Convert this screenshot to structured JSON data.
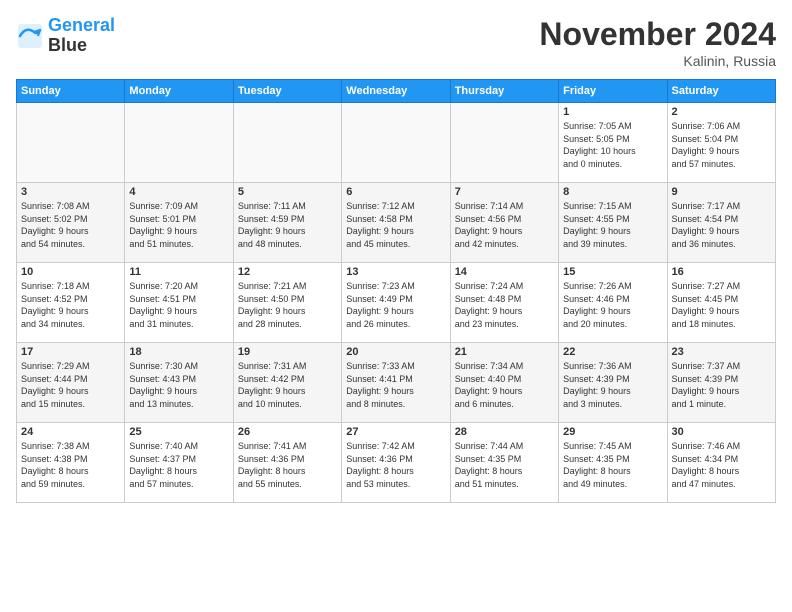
{
  "logo": {
    "line1": "General",
    "line2": "Blue"
  },
  "title": "November 2024",
  "location": "Kalinin, Russia",
  "days_header": [
    "Sunday",
    "Monday",
    "Tuesday",
    "Wednesday",
    "Thursday",
    "Friday",
    "Saturday"
  ],
  "weeks": [
    [
      {
        "day": "",
        "text": ""
      },
      {
        "day": "",
        "text": ""
      },
      {
        "day": "",
        "text": ""
      },
      {
        "day": "",
        "text": ""
      },
      {
        "day": "",
        "text": ""
      },
      {
        "day": "1",
        "text": "Sunrise: 7:05 AM\nSunset: 5:05 PM\nDaylight: 10 hours\nand 0 minutes."
      },
      {
        "day": "2",
        "text": "Sunrise: 7:06 AM\nSunset: 5:04 PM\nDaylight: 9 hours\nand 57 minutes."
      }
    ],
    [
      {
        "day": "3",
        "text": "Sunrise: 7:08 AM\nSunset: 5:02 PM\nDaylight: 9 hours\nand 54 minutes."
      },
      {
        "day": "4",
        "text": "Sunrise: 7:09 AM\nSunset: 5:01 PM\nDaylight: 9 hours\nand 51 minutes."
      },
      {
        "day": "5",
        "text": "Sunrise: 7:11 AM\nSunset: 4:59 PM\nDaylight: 9 hours\nand 48 minutes."
      },
      {
        "day": "6",
        "text": "Sunrise: 7:12 AM\nSunset: 4:58 PM\nDaylight: 9 hours\nand 45 minutes."
      },
      {
        "day": "7",
        "text": "Sunrise: 7:14 AM\nSunset: 4:56 PM\nDaylight: 9 hours\nand 42 minutes."
      },
      {
        "day": "8",
        "text": "Sunrise: 7:15 AM\nSunset: 4:55 PM\nDaylight: 9 hours\nand 39 minutes."
      },
      {
        "day": "9",
        "text": "Sunrise: 7:17 AM\nSunset: 4:54 PM\nDaylight: 9 hours\nand 36 minutes."
      }
    ],
    [
      {
        "day": "10",
        "text": "Sunrise: 7:18 AM\nSunset: 4:52 PM\nDaylight: 9 hours\nand 34 minutes."
      },
      {
        "day": "11",
        "text": "Sunrise: 7:20 AM\nSunset: 4:51 PM\nDaylight: 9 hours\nand 31 minutes."
      },
      {
        "day": "12",
        "text": "Sunrise: 7:21 AM\nSunset: 4:50 PM\nDaylight: 9 hours\nand 28 minutes."
      },
      {
        "day": "13",
        "text": "Sunrise: 7:23 AM\nSunset: 4:49 PM\nDaylight: 9 hours\nand 26 minutes."
      },
      {
        "day": "14",
        "text": "Sunrise: 7:24 AM\nSunset: 4:48 PM\nDaylight: 9 hours\nand 23 minutes."
      },
      {
        "day": "15",
        "text": "Sunrise: 7:26 AM\nSunset: 4:46 PM\nDaylight: 9 hours\nand 20 minutes."
      },
      {
        "day": "16",
        "text": "Sunrise: 7:27 AM\nSunset: 4:45 PM\nDaylight: 9 hours\nand 18 minutes."
      }
    ],
    [
      {
        "day": "17",
        "text": "Sunrise: 7:29 AM\nSunset: 4:44 PM\nDaylight: 9 hours\nand 15 minutes."
      },
      {
        "day": "18",
        "text": "Sunrise: 7:30 AM\nSunset: 4:43 PM\nDaylight: 9 hours\nand 13 minutes."
      },
      {
        "day": "19",
        "text": "Sunrise: 7:31 AM\nSunset: 4:42 PM\nDaylight: 9 hours\nand 10 minutes."
      },
      {
        "day": "20",
        "text": "Sunrise: 7:33 AM\nSunset: 4:41 PM\nDaylight: 9 hours\nand 8 minutes."
      },
      {
        "day": "21",
        "text": "Sunrise: 7:34 AM\nSunset: 4:40 PM\nDaylight: 9 hours\nand 6 minutes."
      },
      {
        "day": "22",
        "text": "Sunrise: 7:36 AM\nSunset: 4:39 PM\nDaylight: 9 hours\nand 3 minutes."
      },
      {
        "day": "23",
        "text": "Sunrise: 7:37 AM\nSunset: 4:39 PM\nDaylight: 9 hours\nand 1 minute."
      }
    ],
    [
      {
        "day": "24",
        "text": "Sunrise: 7:38 AM\nSunset: 4:38 PM\nDaylight: 8 hours\nand 59 minutes."
      },
      {
        "day": "25",
        "text": "Sunrise: 7:40 AM\nSunset: 4:37 PM\nDaylight: 8 hours\nand 57 minutes."
      },
      {
        "day": "26",
        "text": "Sunrise: 7:41 AM\nSunset: 4:36 PM\nDaylight: 8 hours\nand 55 minutes."
      },
      {
        "day": "27",
        "text": "Sunrise: 7:42 AM\nSunset: 4:36 PM\nDaylight: 8 hours\nand 53 minutes."
      },
      {
        "day": "28",
        "text": "Sunrise: 7:44 AM\nSunset: 4:35 PM\nDaylight: 8 hours\nand 51 minutes."
      },
      {
        "day": "29",
        "text": "Sunrise: 7:45 AM\nSunset: 4:35 PM\nDaylight: 8 hours\nand 49 minutes."
      },
      {
        "day": "30",
        "text": "Sunrise: 7:46 AM\nSunset: 4:34 PM\nDaylight: 8 hours\nand 47 minutes."
      }
    ]
  ]
}
